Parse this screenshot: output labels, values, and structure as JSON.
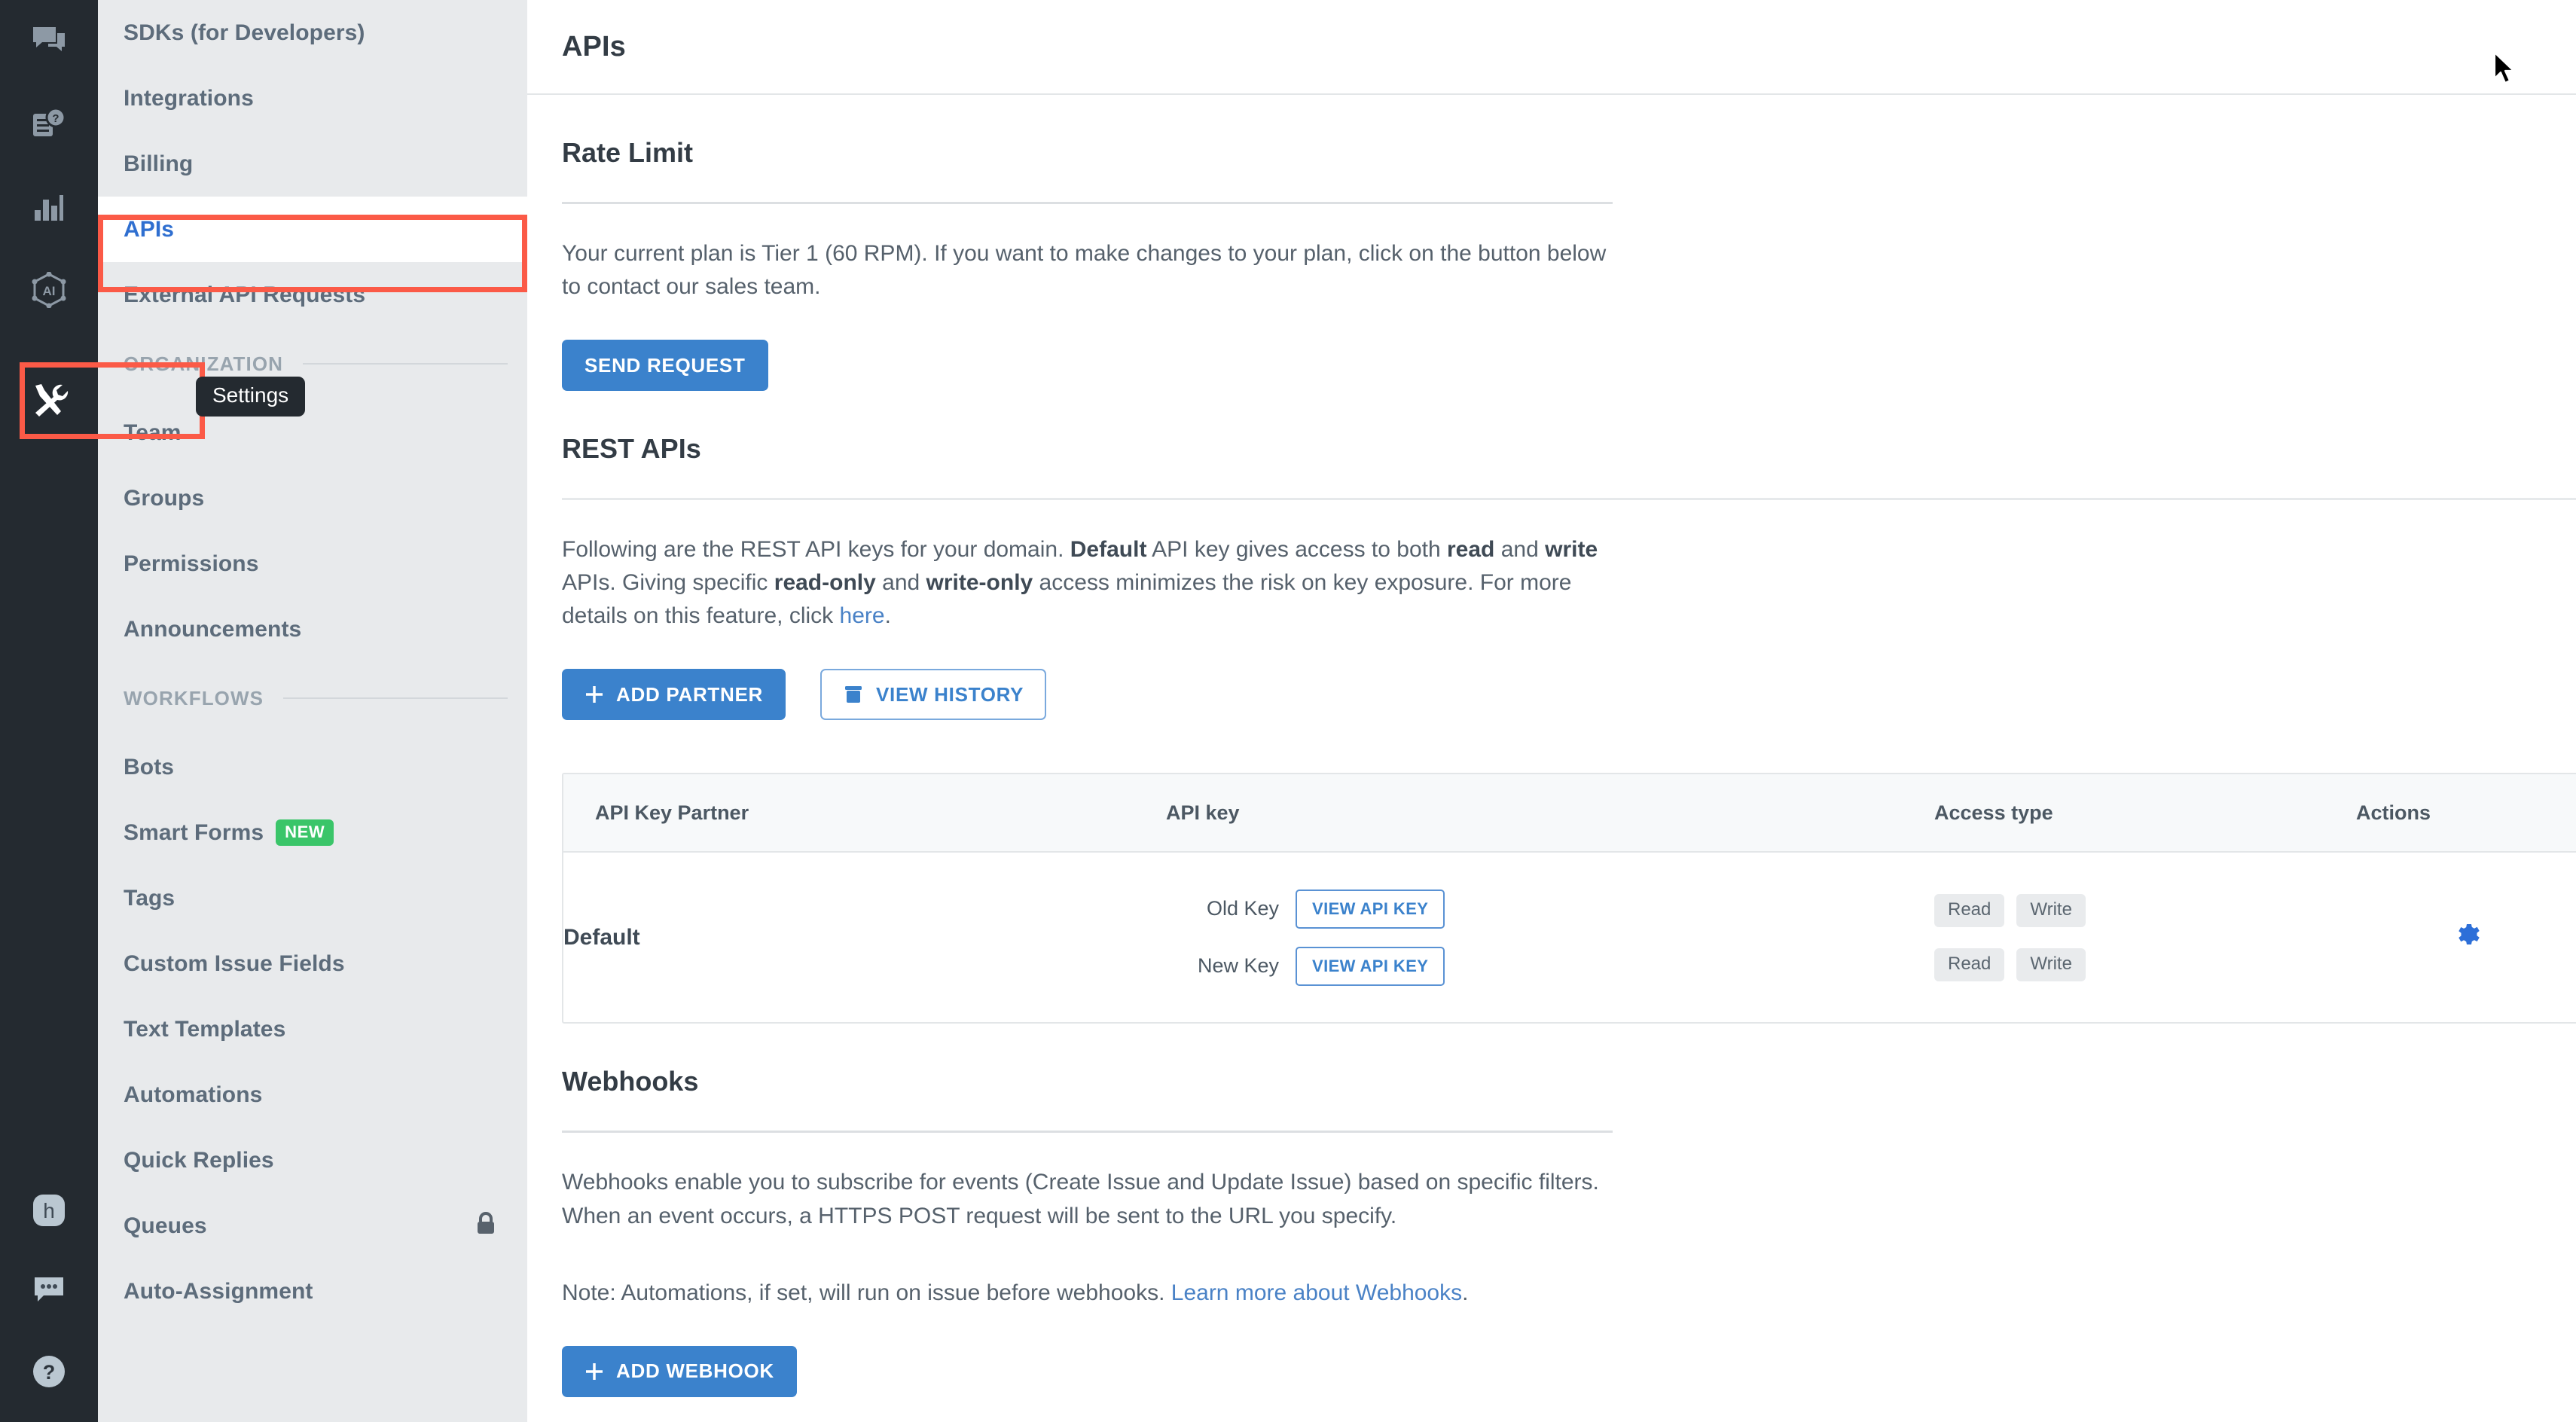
{
  "icon_rail": {
    "items": [
      {
        "name": "chat-icon",
        "label": "Chats"
      },
      {
        "name": "knowledge-base-icon",
        "label": "Knowledge Base"
      },
      {
        "name": "analytics-icon",
        "label": "Analytics"
      },
      {
        "name": "ai-icon",
        "label": "AI"
      },
      {
        "name": "settings-tools-icon",
        "label": "Settings"
      }
    ],
    "bottom_items": [
      {
        "name": "helpshift-logo-icon",
        "label": "h"
      },
      {
        "name": "feedback-chat-icon",
        "label": "Feedback"
      },
      {
        "name": "help-question-icon",
        "label": "Help"
      }
    ]
  },
  "tooltip": {
    "text": "Settings"
  },
  "sidebar": {
    "top_items": [
      {
        "label": "SDKs (for Developers)",
        "selected": false
      },
      {
        "label": "Integrations",
        "selected": false
      },
      {
        "label": "Billing",
        "selected": false
      },
      {
        "label": "APIs",
        "selected": true
      },
      {
        "label": "External API Requests",
        "selected": false
      }
    ],
    "sections": [
      {
        "title": "ORGANIZATION",
        "items": [
          {
            "label": "Team"
          },
          {
            "label": "Groups"
          },
          {
            "label": "Permissions"
          },
          {
            "label": "Announcements"
          }
        ]
      },
      {
        "title": "WORKFLOWS",
        "items": [
          {
            "label": "Bots"
          },
          {
            "label": "Smart Forms",
            "badge": "NEW"
          },
          {
            "label": "Tags"
          },
          {
            "label": "Custom Issue Fields"
          },
          {
            "label": "Text Templates"
          },
          {
            "label": "Automations"
          },
          {
            "label": "Quick Replies"
          },
          {
            "label": "Queues",
            "locked": true
          },
          {
            "label": "Auto-Assignment"
          }
        ]
      }
    ]
  },
  "header": {
    "title": "APIs"
  },
  "rate_limit": {
    "title": "Rate Limit",
    "description": "Your current plan is Tier 1 (60 RPM). If you want to make changes to your plan, click on the button below to contact our sales team.",
    "send_request_label": "SEND REQUEST"
  },
  "rest_apis": {
    "title": "REST APIs",
    "desc_part1": "Following are the REST API keys for your domain. ",
    "desc_b1": "Default",
    "desc_part2": " API key gives access to both ",
    "desc_b2": "read",
    "desc_part3": " and ",
    "desc_b3": "write",
    "desc_part4": " APIs. Giving specific ",
    "desc_b4": "read-only",
    "desc_part5": " and ",
    "desc_b5": "write-only",
    "desc_part6": " access minimizes the risk on key exposure. For more details on this feature, click ",
    "desc_link": "here",
    "desc_part7": ".",
    "add_partner_label": "ADD PARTNER",
    "view_history_label": "VIEW HISTORY",
    "table": {
      "columns": [
        "API Key Partner",
        "API key",
        "Access type",
        "Actions"
      ],
      "rows": [
        {
          "partner": "Default",
          "keys": [
            {
              "label": "Old Key",
              "button": "VIEW API KEY",
              "access": [
                "Read",
                "Write"
              ]
            },
            {
              "label": "New Key",
              "button": "VIEW API KEY",
              "access": [
                "Read",
                "Write"
              ]
            }
          ]
        }
      ]
    }
  },
  "webhooks": {
    "title": "Webhooks",
    "desc": "Webhooks enable you to subscribe for events (Create Issue and Update Issue) based on specific filters. When an event occurs, a HTTPS POST request will be sent to the URL you specify.",
    "note_prefix": "Note: Automations, if set, will run on issue before webhooks. ",
    "note_link": "Learn more about Webhooks",
    "note_suffix": ".",
    "add_webhook_label": "ADD WEBHOOK"
  },
  "colors": {
    "accent_blue": "#3b82cc",
    "highlight_red": "#fb5a47",
    "badge_green": "#3ac569",
    "rail_dark": "#242a30",
    "sidebar_bg": "#e8eaec"
  }
}
